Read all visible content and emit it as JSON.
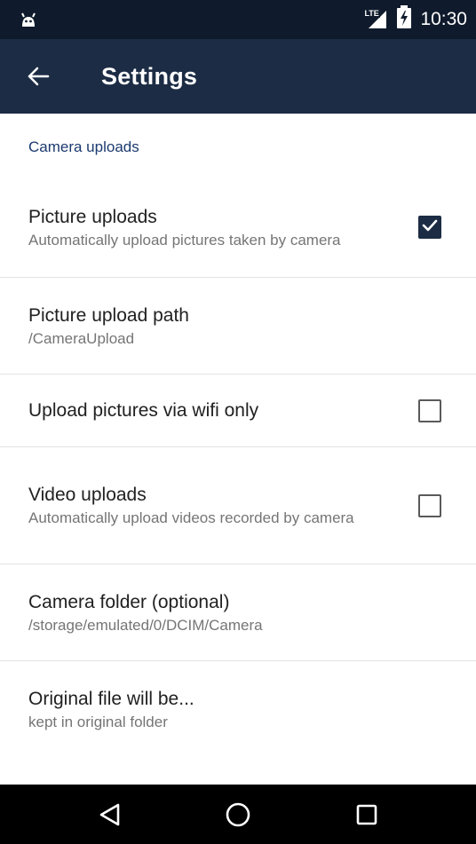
{
  "status_bar": {
    "time": "10:30",
    "network_label": "LTE",
    "icons": [
      "android-icon",
      "lte-signal-icon",
      "battery-charging-icon"
    ]
  },
  "app_bar": {
    "title": "Settings",
    "back_icon": "arrow-left-icon"
  },
  "section": {
    "header": "Camera uploads"
  },
  "preferences": [
    {
      "title": "Picture uploads",
      "summary": "Automatically upload pictures taken by camera",
      "checkbox": true
    },
    {
      "title": "Picture upload path",
      "summary": "/CameraUpload"
    },
    {
      "title": "Upload pictures via wifi only",
      "checkbox": false
    },
    {
      "title": "Video uploads",
      "summary": "Automatically upload videos recorded by camera",
      "checkbox": false
    },
    {
      "title": "Camera folder (optional)",
      "summary": "/storage/emulated/0/DCIM/Camera"
    },
    {
      "title": "Original file will be...",
      "summary": "kept in original folder"
    }
  ],
  "nav_bar": {
    "icons": [
      "back-triangle-icon",
      "home-circle-icon",
      "recents-square-icon"
    ]
  },
  "colors": {
    "status_bar": "#0f1b2c",
    "app_bar": "#1c2c44",
    "section_header": "#1c3a70",
    "checkbox_checked": "#1c2c44"
  }
}
